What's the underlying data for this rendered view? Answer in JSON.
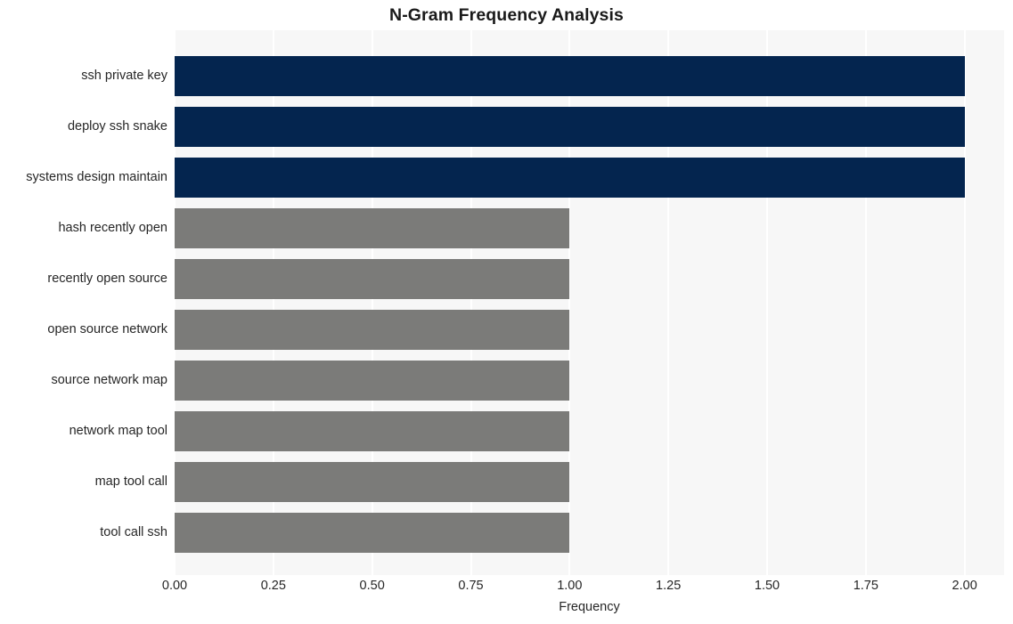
{
  "chart_data": {
    "type": "bar",
    "orientation": "horizontal",
    "title": "N-Gram Frequency Analysis",
    "xlabel": "Frequency",
    "ylabel": "",
    "categories": [
      "ssh private key",
      "deploy ssh snake",
      "systems design maintain",
      "hash recently open",
      "recently open source",
      "open source network",
      "source network map",
      "network map tool",
      "map tool call",
      "tool call ssh"
    ],
    "values": [
      2,
      2,
      2,
      1,
      1,
      1,
      1,
      1,
      1,
      1
    ],
    "bar_colors": [
      "#04254f",
      "#04254f",
      "#04254f",
      "#7b7b79",
      "#7b7b79",
      "#7b7b79",
      "#7b7b79",
      "#7b7b79",
      "#7b7b79",
      "#7b7b79"
    ],
    "xlim": [
      0.0,
      2.1
    ],
    "xticks": [
      0.0,
      0.25,
      0.5,
      0.75,
      1.0,
      1.25,
      1.5,
      1.75,
      2.0
    ],
    "xtick_labels": [
      "0.00",
      "0.25",
      "0.50",
      "0.75",
      "1.00",
      "1.25",
      "1.50",
      "1.75",
      "2.00"
    ],
    "grid": true,
    "grid_axis": "x",
    "legend": null,
    "plot_background": "#f7f7f7",
    "grid_color": "#ffffff",
    "figure_background": "#ffffff",
    "highlight_color": "#04254f",
    "base_color": "#7b7b79"
  }
}
